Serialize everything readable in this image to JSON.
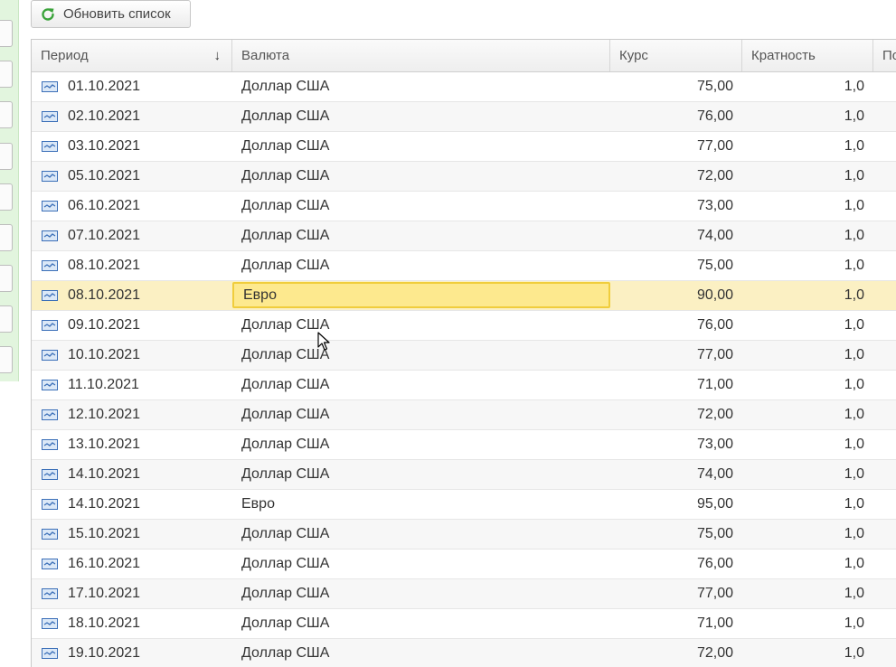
{
  "toolbar": {
    "refresh_label": "Обновить список"
  },
  "table": {
    "columns": {
      "period": "Период",
      "currency": "Валюта",
      "rate": "Курс",
      "multiplicity": "Кратность",
      "extra": "По"
    },
    "sort_indicator": "↓",
    "selected_index": 7,
    "rows": [
      {
        "period": "01.10.2021",
        "currency": "Доллар США",
        "rate": "75,00",
        "multiplicity": "1,0"
      },
      {
        "period": "02.10.2021",
        "currency": "Доллар США",
        "rate": "76,00",
        "multiplicity": "1,0"
      },
      {
        "period": "03.10.2021",
        "currency": "Доллар США",
        "rate": "77,00",
        "multiplicity": "1,0"
      },
      {
        "period": "05.10.2021",
        "currency": "Доллар США",
        "rate": "72,00",
        "multiplicity": "1,0"
      },
      {
        "period": "06.10.2021",
        "currency": "Доллар США",
        "rate": "73,00",
        "multiplicity": "1,0"
      },
      {
        "period": "07.10.2021",
        "currency": "Доллар США",
        "rate": "74,00",
        "multiplicity": "1,0"
      },
      {
        "period": "08.10.2021",
        "currency": "Доллар США",
        "rate": "75,00",
        "multiplicity": "1,0"
      },
      {
        "period": "08.10.2021",
        "currency": "Евро",
        "rate": "90,00",
        "multiplicity": "1,0"
      },
      {
        "period": "09.10.2021",
        "currency": "Доллар США",
        "rate": "76,00",
        "multiplicity": "1,0"
      },
      {
        "period": "10.10.2021",
        "currency": "Доллар США",
        "rate": "77,00",
        "multiplicity": "1,0"
      },
      {
        "period": "11.10.2021",
        "currency": "Доллар США",
        "rate": "71,00",
        "multiplicity": "1,0"
      },
      {
        "period": "12.10.2021",
        "currency": "Доллар США",
        "rate": "72,00",
        "multiplicity": "1,0"
      },
      {
        "period": "13.10.2021",
        "currency": "Доллар США",
        "rate": "73,00",
        "multiplicity": "1,0"
      },
      {
        "period": "14.10.2021",
        "currency": "Доллар США",
        "rate": "74,00",
        "multiplicity": "1,0"
      },
      {
        "period": "14.10.2021",
        "currency": "Евро",
        "rate": "95,00",
        "multiplicity": "1,0"
      },
      {
        "period": "15.10.2021",
        "currency": "Доллар США",
        "rate": "75,00",
        "multiplicity": "1,0"
      },
      {
        "period": "16.10.2021",
        "currency": "Доллар США",
        "rate": "76,00",
        "multiplicity": "1,0"
      },
      {
        "period": "17.10.2021",
        "currency": "Доллар США",
        "rate": "77,00",
        "multiplicity": "1,0"
      },
      {
        "period": "18.10.2021",
        "currency": "Доллар США",
        "rate": "71,00",
        "multiplicity": "1,0"
      },
      {
        "period": "19.10.2021",
        "currency": "Доллар США",
        "rate": "72,00",
        "multiplicity": "1,0"
      }
    ]
  },
  "colors": {
    "refresh_icon": "#3aa33a",
    "row_icon": "#3b6fb8",
    "selected_row": "#fbf0c3",
    "selected_cell": "#fde98e",
    "left_panel": "#e2f5de"
  }
}
